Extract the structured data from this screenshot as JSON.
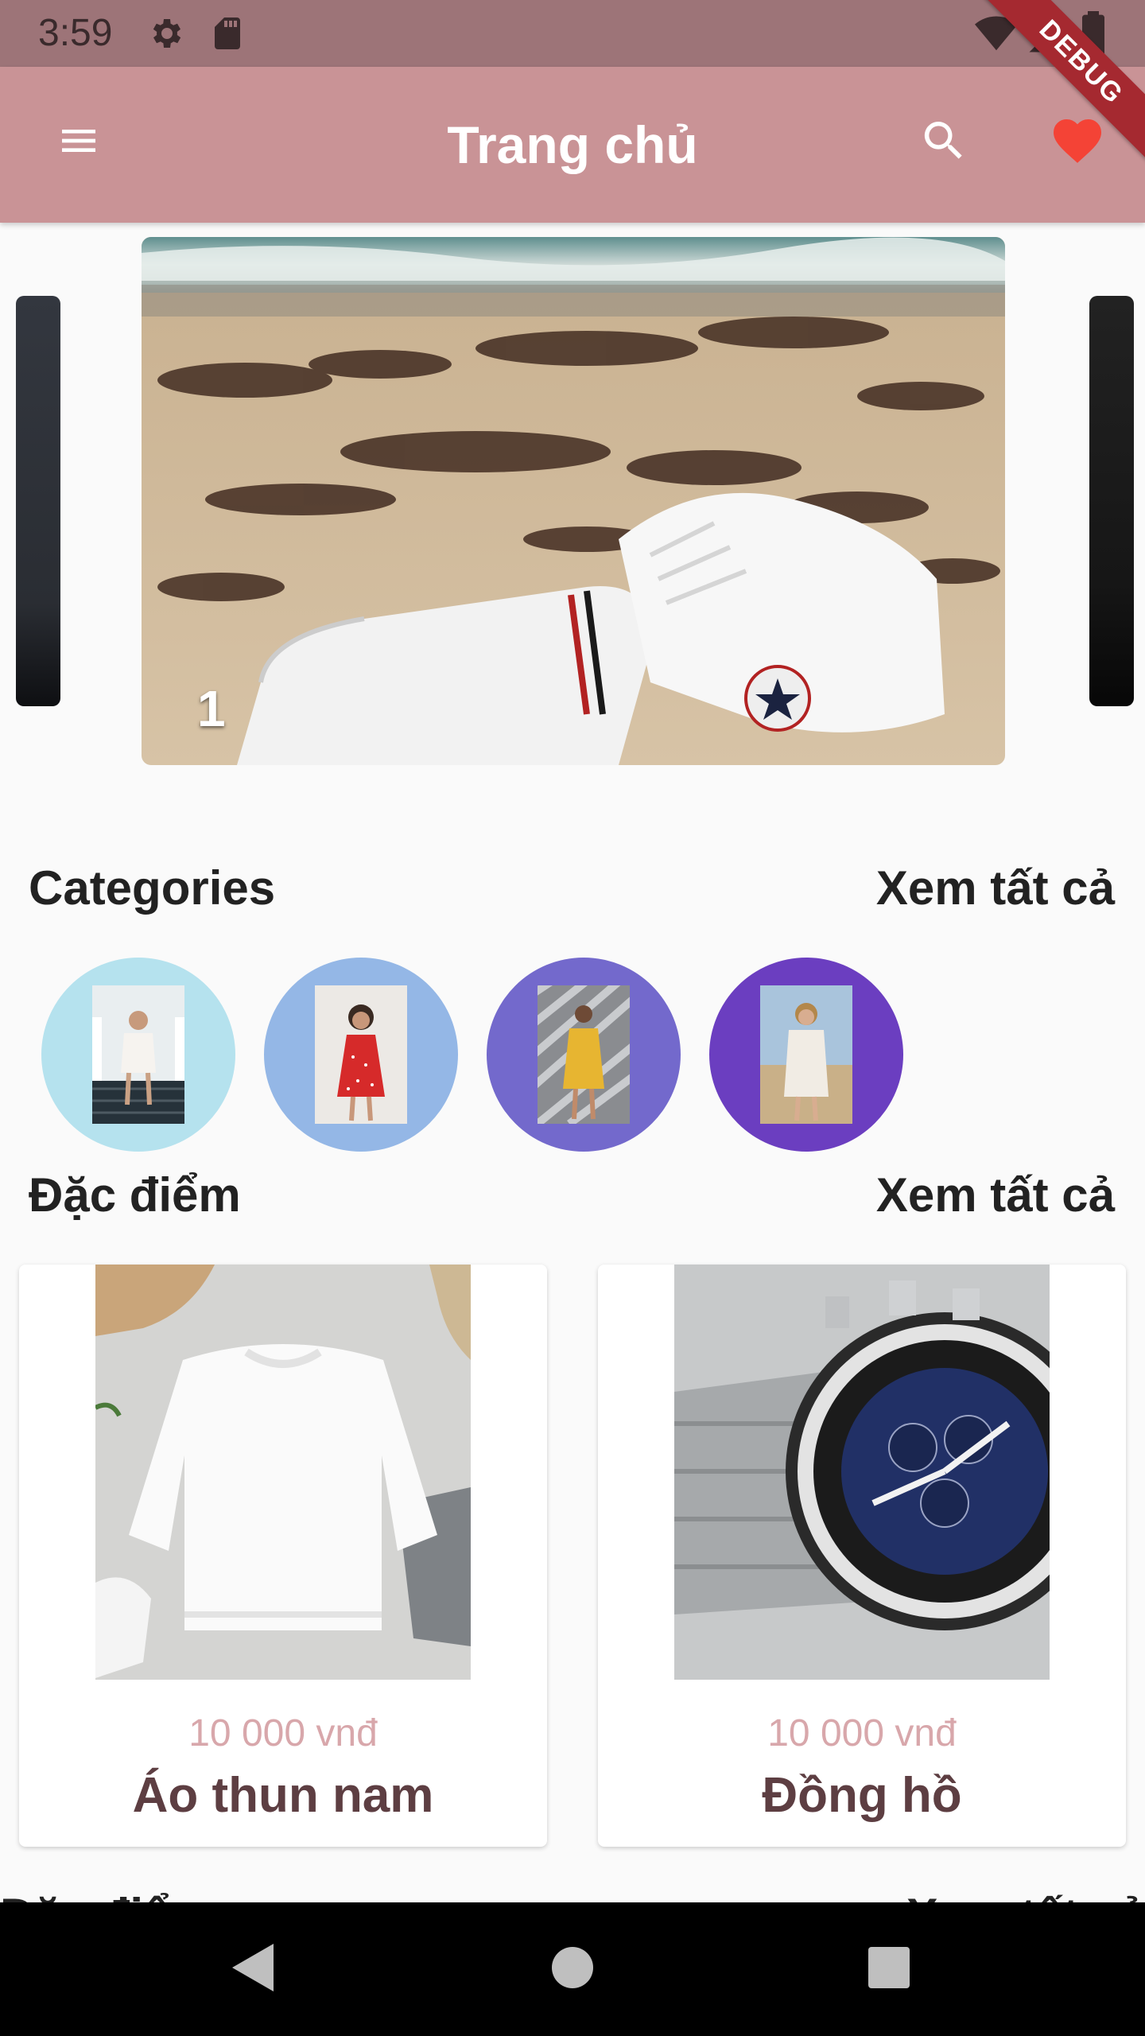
{
  "status_bar": {
    "time": "3:59",
    "icons": [
      "gear-icon",
      "sd-card-icon",
      "wifi-icon",
      "signal-icon",
      "battery-icon"
    ]
  },
  "app_bar": {
    "title": "Trang chủ",
    "menu_icon": "menu-icon",
    "search_icon": "search-icon",
    "favorite_icon": "heart-icon",
    "favorite_color": "#f44336",
    "background_color": "#c99396"
  },
  "debug_banner": "DEBUG",
  "carousel": {
    "current_index": "1"
  },
  "categories_section": {
    "title": "Categories",
    "see_all": "Xem tất cả",
    "items": [
      {
        "color": "#b5e2ee"
      },
      {
        "color": "#94b7e6"
      },
      {
        "color": "#7369cc"
      },
      {
        "color": "#6b3ec0"
      }
    ]
  },
  "featured_section": {
    "title": "Đặc điểm",
    "see_all": "Xem tất cả",
    "products": [
      {
        "price": "10 000 vnđ",
        "name": "Áo thun nam"
      },
      {
        "price": "10 000 vnđ",
        "name": "Đồng hồ"
      }
    ]
  },
  "next_section": {
    "title": "Đặc điểm",
    "see_all": "Xem tất cả"
  },
  "nav_bar": {
    "back_icon": "back-triangle-icon",
    "home_icon": "home-circle-icon",
    "recents_icon": "recents-square-icon"
  }
}
